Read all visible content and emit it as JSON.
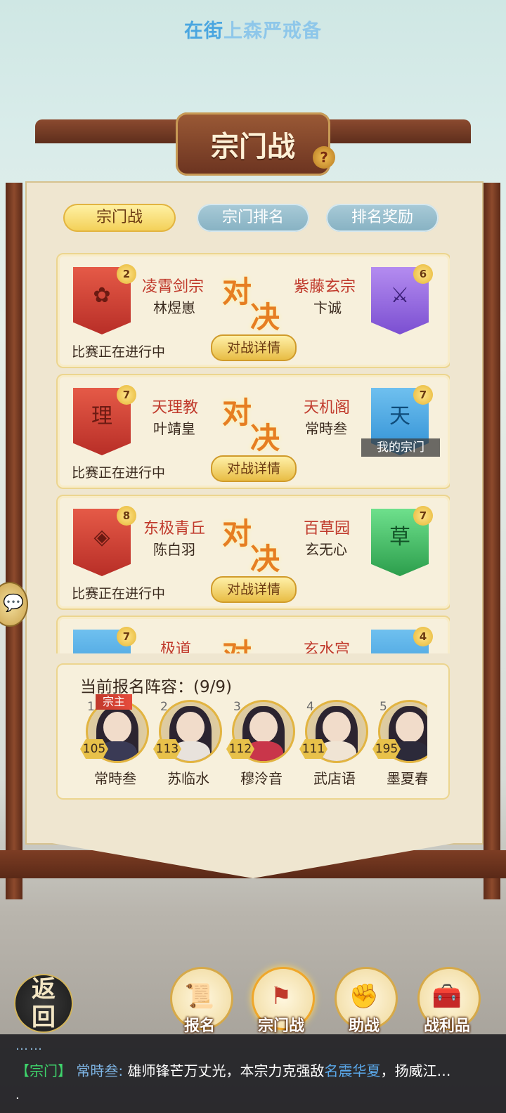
{
  "announcement": {
    "highlight": "在街",
    "rest": "上森严戒备"
  },
  "header": {
    "title": "宗门战",
    "help_icon": "?"
  },
  "tabs": [
    {
      "label": "宗门战",
      "active": true
    },
    {
      "label": "宗门排名",
      "active": false
    },
    {
      "label": "排名奖励",
      "active": false
    }
  ],
  "vs_text": {
    "top": "对",
    "bottom": "决"
  },
  "matches": [
    {
      "left": {
        "sect": "凌霄剑宗",
        "leader": "林煜崽",
        "rank": "2",
        "flag_color": "red",
        "emblem": "lotus-icon",
        "glyph": ""
      },
      "right": {
        "sect": "紫藤玄宗",
        "leader": "卞诚",
        "rank": "6",
        "flag_color": "purple",
        "emblem": "crossed-swords-icon",
        "glyph": ""
      },
      "status": "比赛正在进行中",
      "detail_label": "对战详情",
      "mine_label": ""
    },
    {
      "left": {
        "sect": "天理教",
        "leader": "叶靖皇",
        "rank": "7",
        "flag_color": "red",
        "emblem": "",
        "glyph": "理"
      },
      "right": {
        "sect": "天机阁",
        "leader": "常時叁",
        "rank": "7",
        "flag_color": "blue",
        "emblem": "",
        "glyph": "天"
      },
      "status": "比赛正在进行中",
      "detail_label": "对战详情",
      "mine_label": "我的宗门"
    },
    {
      "left": {
        "sect": "东极青丘",
        "leader": "陈白羽",
        "rank": "8",
        "flag_color": "red",
        "emblem": "coin-icon",
        "glyph": ""
      },
      "right": {
        "sect": "百草园",
        "leader": "玄无心",
        "rank": "7",
        "flag_color": "green",
        "emblem": "",
        "glyph": "草"
      },
      "status": "比赛正在进行中",
      "detail_label": "对战详情",
      "mine_label": ""
    },
    {
      "left": {
        "sect": "极道",
        "leader": "",
        "rank": "7",
        "flag_color": "blue",
        "emblem": "",
        "glyph": ""
      },
      "right": {
        "sect": "玄水宫",
        "leader": "",
        "rank": "4",
        "flag_color": "blue",
        "emblem": "",
        "glyph": ""
      },
      "status": "",
      "detail_label": "",
      "mine_label": ""
    }
  ],
  "roster": {
    "title": "当前报名阵容：(9/9)",
    "chief_label": "宗主",
    "heroes": [
      {
        "num": "1",
        "level": "105",
        "name": "常時叁"
      },
      {
        "num": "2",
        "level": "113",
        "name": "苏临水"
      },
      {
        "num": "3",
        "level": "112",
        "name": "穆泠音"
      },
      {
        "num": "4",
        "level": "111",
        "name": "武店语"
      },
      {
        "num": "5",
        "level": "195",
        "name": "墨夏春"
      }
    ]
  },
  "nav": {
    "back": {
      "top": "返",
      "bottom": "回"
    },
    "items": [
      {
        "label": "报名",
        "icon": "scroll-brush-icon"
      },
      {
        "label": "宗门战",
        "icon": "war-flag-icon",
        "active": true
      },
      {
        "label": "助战",
        "icon": "handshake-icon"
      },
      {
        "label": "战利品",
        "icon": "treasure-chest-icon"
      }
    ]
  },
  "chat": {
    "dots": "……",
    "tag": "【宗门】",
    "speaker": "常時叁:",
    "text1": "雄师锋芒万丈光，本宗力克强敌",
    "highlight": "名震华夏",
    "text2": "，扬威江…",
    "trailing": "."
  },
  "colors": {
    "accent_gold": "#e2b441",
    "sect_red": "#c0392b",
    "vs_orange": "#e67e22"
  }
}
